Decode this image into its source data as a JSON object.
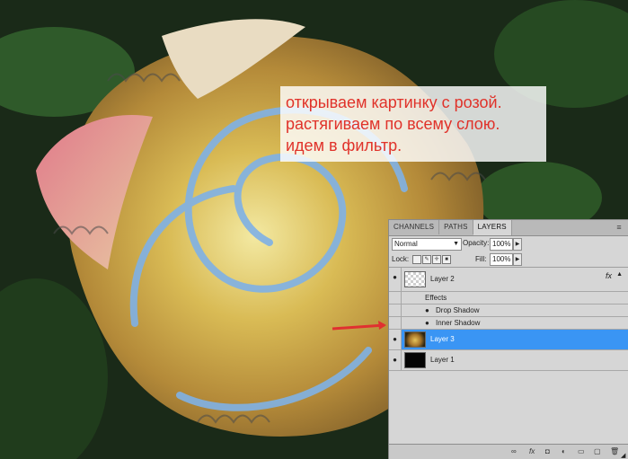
{
  "note": {
    "lines": [
      "открываем картинку с розой.",
      "растягиваем по всему слою.",
      "идем в фильтр."
    ],
    "text_color": "#e0322a"
  },
  "layers_panel": {
    "tabs": [
      {
        "label": "CHANNELS"
      },
      {
        "label": "PATHS"
      },
      {
        "label": "LAYERS"
      }
    ],
    "active_tab": "LAYERS",
    "panel_menu_icon": "panel-menu-icon",
    "blend_mode": "Normal",
    "opacity_label": "Opacity:",
    "opacity_value": "100%",
    "lock_label": "Lock:",
    "fill_label": "Fill:",
    "fill_value": "100%",
    "lock_icons": [
      "lock-transparent-icon",
      "lock-image-icon",
      "lock-position-icon",
      "lock-all-icon"
    ],
    "layers": [
      {
        "name": "Layer 2",
        "has_fx": true,
        "fx_label": "fx"
      },
      {
        "name": "Effects"
      },
      {
        "name": "Drop Shadow"
      },
      {
        "name": "Inner Shadow"
      },
      {
        "name": "Layer 3",
        "selected": true
      },
      {
        "name": "Layer 1"
      }
    ],
    "bottom_icons": [
      "link-layers-icon",
      "add-style-icon",
      "add-mask-icon",
      "adjustment-layer-icon",
      "group-icon",
      "new-layer-icon",
      "delete-layer-icon"
    ],
    "selection_color": "#3a95f4"
  },
  "annotation": {
    "arrow_color": "#e03030"
  }
}
